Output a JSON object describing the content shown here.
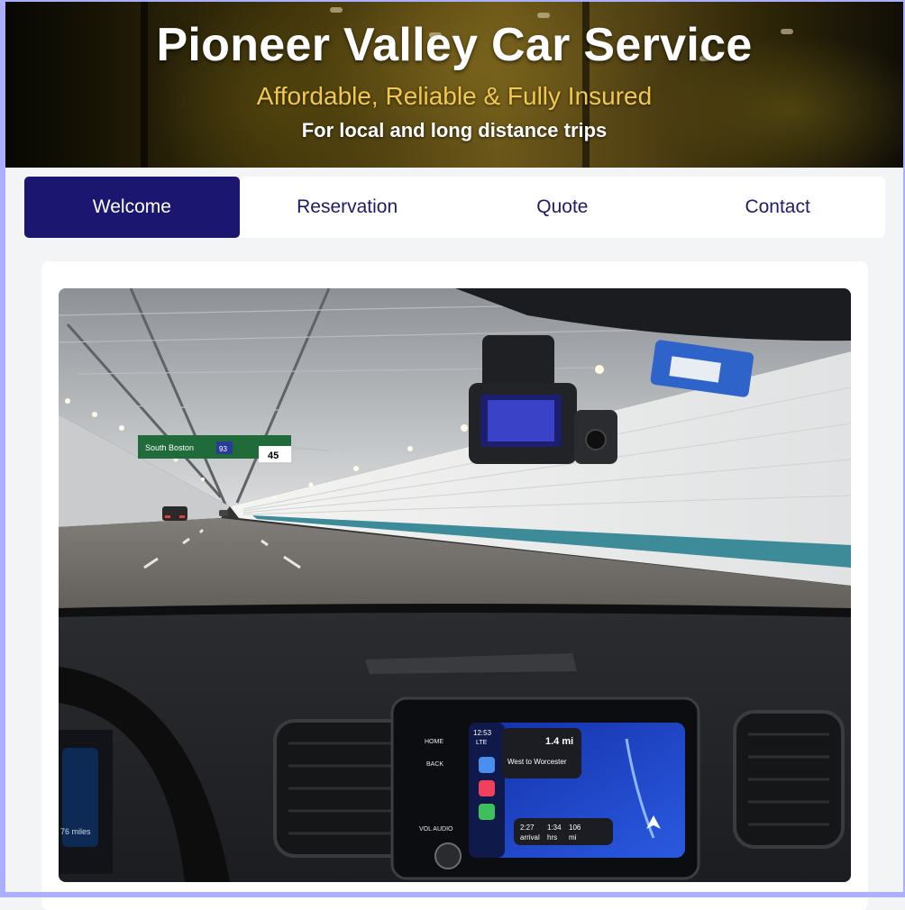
{
  "header": {
    "title": "Pioneer Valley Car Service",
    "tagline": "Affordable, Reliable & Fully Insured",
    "subtitle": "For local and long distance trips"
  },
  "nav": {
    "tabs": [
      {
        "label": "Welcome",
        "active": true
      },
      {
        "label": "Reservation",
        "active": false
      },
      {
        "label": "Quote",
        "active": false
      },
      {
        "label": "Contact",
        "active": false
      }
    ]
  },
  "photo": {
    "sign_text": "South Boston",
    "sign_route": "93",
    "sign_miles": "45",
    "screen": {
      "time": "12:53",
      "signal": "LTE",
      "distance": "1.4 mi",
      "direction": "West to Worcester",
      "arrival": "2:27",
      "arrival_label": "arrival",
      "hrs": "1:34",
      "hrs_label": "hrs",
      "mi": "106",
      "mi_label": "mi"
    },
    "odometer": "76 miles",
    "buttons": {
      "home": "HOME",
      "back": "BACK",
      "vol": "VOL AUDIO"
    }
  },
  "colors": {
    "nav_active_bg": "#1b1670",
    "nav_text": "#1f1c66",
    "tagline": "#f2c94c"
  }
}
